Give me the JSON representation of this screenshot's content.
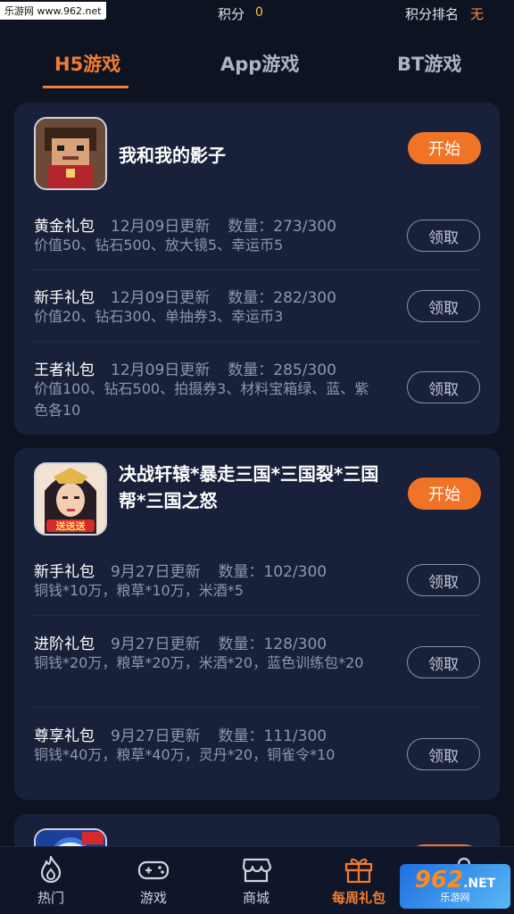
{
  "status": {
    "watermark_cn": "乐游网",
    "watermark_url": "www.962.net",
    "score_label": "积分",
    "score_value": "0",
    "rank_label": "积分排名",
    "rank_value": "无"
  },
  "tabs": [
    {
      "label": "H5游戏",
      "active": true
    },
    {
      "label": "App游戏",
      "active": false
    },
    {
      "label": "BT游戏",
      "active": false
    }
  ],
  "games": [
    {
      "title": "我和我的影子",
      "start_label": "开始",
      "packs": [
        {
          "name": "黄金礼包",
          "date": "12月09日更新",
          "qty": "数量：273/300",
          "desc": "价值50、钻石500、放大镜5、幸运币5",
          "claim": "领取"
        },
        {
          "name": "新手礼包",
          "date": "12月09日更新",
          "qty": "数量：282/300",
          "desc": "价值20、钻石300、单抽券3、幸运币3",
          "claim": "领取"
        },
        {
          "name": "王者礼包",
          "date": "12月09日更新",
          "qty": "数量：285/300",
          "desc": "价值100、钻石500、拍摄券3、材料宝箱绿、蓝、紫色各10",
          "claim": "领取"
        }
      ]
    },
    {
      "title": "决战轩辕*暴走三国*三国裂*三国帮*三国之怒",
      "start_label": "开始",
      "icon_badge": "送送送",
      "packs": [
        {
          "name": "新手礼包",
          "date": "9月27日更新",
          "qty": "数量：102/300",
          "desc": "铜钱*10万，粮草*10万，米酒*5",
          "claim": "领取"
        },
        {
          "name": "进阶礼包",
          "date": "9月27日更新",
          "qty": "数量：128/300",
          "desc": "铜钱*20万，粮草*20万，米酒*20，蓝色训练包*20",
          "claim": "领取"
        },
        {
          "name": "尊享礼包",
          "date": "9月27日更新",
          "qty": "数量：111/300",
          "desc": "铜钱*40万，粮草*40万，灵丹*20，铜雀令*10",
          "claim": "领取"
        }
      ]
    }
  ],
  "nav": [
    {
      "label": "热门",
      "icon": "flame-icon",
      "active": false
    },
    {
      "label": "游戏",
      "icon": "gamepad-icon",
      "active": false
    },
    {
      "label": "商城",
      "icon": "store-icon",
      "active": false
    },
    {
      "label": "每周礼包",
      "icon": "gift-icon",
      "active": true
    }
  ],
  "brand": {
    "big": "962",
    "suffix": ".NET",
    "small": "乐游网"
  },
  "colors": {
    "accent": "#f07d33",
    "background": "#0e1322",
    "card": "#19213a"
  }
}
